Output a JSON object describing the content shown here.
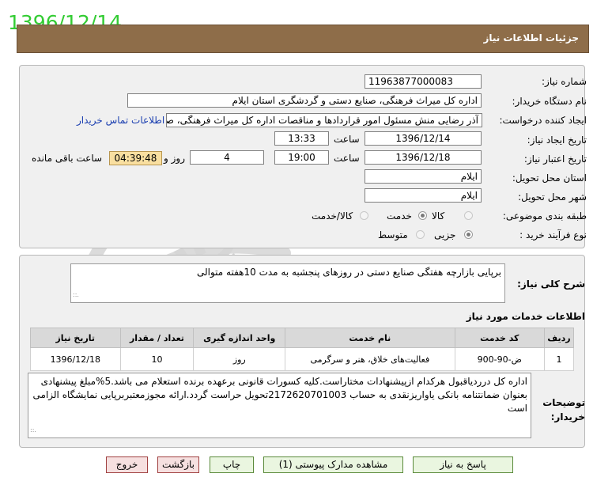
{
  "stamp_date": "1396/12/14",
  "header": {
    "title": "جزئیات اطلاعات نیاز"
  },
  "form": {
    "need_number_label": "شماره نیاز:",
    "need_number": "11963877000083",
    "buyer_org_label": "نام دستگاه خریدار:",
    "buyer_org": "اداره کل میراث فرهنگی، صنایع دستی و گردشگری استان ایلام",
    "creator_label": "ایجاد کننده درخواست:",
    "creator": "آذر رضایی منش مسئول امور قراردادها و مناقصات اداره کل میراث فرهنگی، صنایع دستی و گردشگری استان ایلام",
    "buyer_contact_link": "اطلاعات تماس خریدار",
    "announce_date_label": "تاریخ ایجاد نیاز:",
    "announce_date": "1396/12/14",
    "time_label": "ساعت",
    "announce_time": "13:33",
    "validity_date_label": "تاریخ اعتبار نیاز:",
    "validity_date": "1396/12/18",
    "validity_time": "19:00",
    "days_value": "4",
    "days_label": "روز و",
    "countdown": "04:39:48",
    "remaining_label": "ساعت باقی مانده",
    "province_label": "استان محل تحویل:",
    "province": "ایلام",
    "city_label": "شهر محل تحویل:",
    "city": "ایلام",
    "category_label": "طبقه بندی موضوعی:",
    "category_options": [
      "کالا",
      "خدمت",
      "کالا/خدمت"
    ],
    "category_selected": "خدمت",
    "purchase_type_label": "نوع فرآیند خرید :",
    "purchase_options": [
      "جزیی",
      "متوسط"
    ],
    "purchase_selected": "جزیی"
  },
  "description": {
    "label": "شرح کلی نیاز:",
    "text": "برپایی بازارچه هفتگی صنایع دستی در روزهای پنجشبه به مدت 10هفته متوالی"
  },
  "services": {
    "section_title": "اطلاعات خدمات مورد نیاز",
    "columns": [
      "ردیف",
      "کد خدمت",
      "نام خدمت",
      "واحد اندازه گیری",
      "تعداد / مقدار",
      "تاریخ نیاز"
    ],
    "rows": [
      {
        "row": "1",
        "code": "ض-90-900",
        "name": "فعالیت‌های خلاق، هنر و سرگرمی",
        "unit": "روز",
        "qty": "10",
        "date": "1396/12/18"
      }
    ]
  },
  "buyer_notes": {
    "label": "توضیحات خریدار:",
    "text": "اداره کل درردیاقبول هرکدام ازپیشنهادات مختاراست.کلیه کسورات قانونی برعهده برنده استعلام می باشد.5%مبلغ پیشنهادی بعنوان ضمانتنامه بانکی یاواریزنقدی به حساب 2172620701003تحویل حراست گردد.ارائه مجوزمعتبربرپایی نمایشگاه الزامی است"
  },
  "buttons": {
    "reply": "پاسخ به نیاز",
    "attachments": "مشاهده مدارک پیوستی (1)",
    "print": "چاپ",
    "back": "بازگشت",
    "exit": "خروج"
  },
  "colors": {
    "header_bg": "#8e6d49",
    "stamp": "#33cc33",
    "link": "#1a3eb0",
    "countdown_bg": "#f9dfa0"
  }
}
